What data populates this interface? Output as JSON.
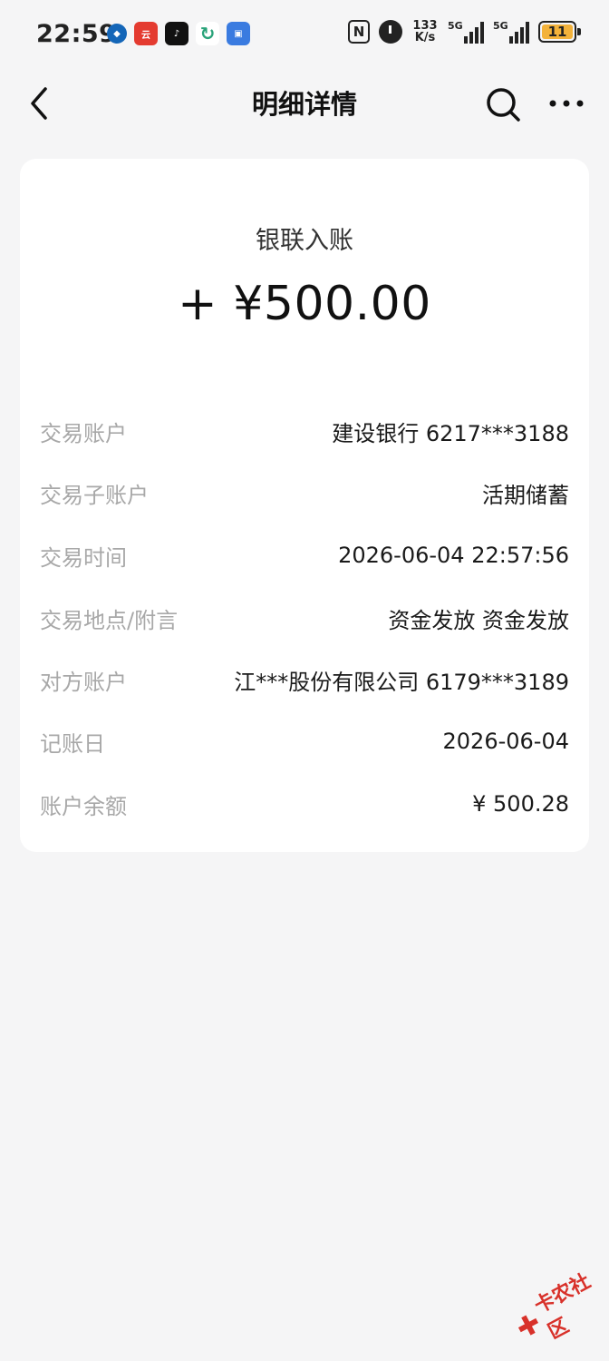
{
  "statusbar": {
    "time": "22:59",
    "speed_top": "133",
    "speed_bottom": "K/s",
    "sim1": "5G",
    "sim2": "5G",
    "battery": "11",
    "apps": [
      {
        "name": "cmb-app-icon",
        "color": "#1466b8",
        "glyph": "◆"
      },
      {
        "name": "news-app-icon",
        "color": "#e43b30",
        "glyph": "云"
      },
      {
        "name": "tiktok-app-icon",
        "color": "#111111",
        "glyph": "♪"
      },
      {
        "name": "sync-app-icon",
        "color": "#ffffff",
        "glyph": "↻"
      },
      {
        "name": "shield-app-icon",
        "color": "#3a7be0",
        "glyph": "▣"
      }
    ]
  },
  "nav": {
    "title": "明细详情"
  },
  "detail": {
    "type": "银联入账",
    "amount": "+ ¥500.00",
    "rows": [
      {
        "label": "交易账户",
        "value": "建设银行 6217***3188"
      },
      {
        "label": "交易子账户",
        "value": "活期储蓄"
      },
      {
        "label": "交易时间",
        "value": "2026-06-04 22:57:56"
      },
      {
        "label": "交易地点/附言",
        "value": "资金发放 资金发放"
      },
      {
        "label": "对方账户",
        "value": "江***股份有限公司 6179***3189"
      },
      {
        "label": "记账日",
        "value": "2026-06-04"
      },
      {
        "label": "账户余额",
        "value": "¥ 500.28"
      }
    ]
  },
  "watermark": {
    "text": "卡农社区"
  }
}
